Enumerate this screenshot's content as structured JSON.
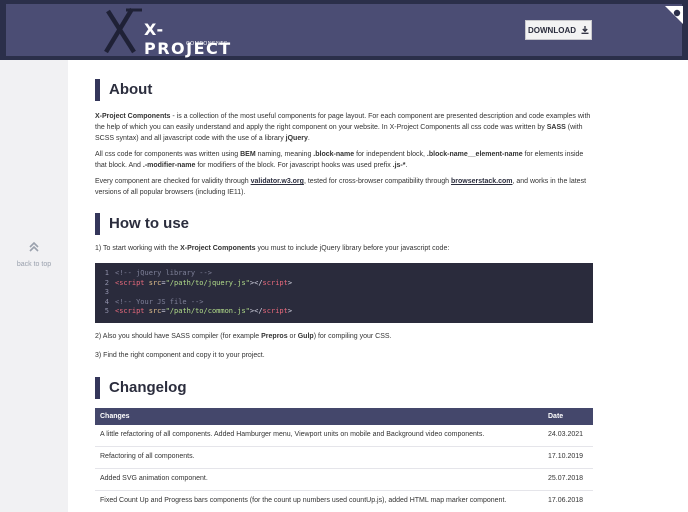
{
  "header": {
    "logo_main": "X-PROJECT",
    "logo_sub": "COMPONENTS",
    "download_label": "DOWNLOAD"
  },
  "sidebar": {
    "back_to_top": "back to top"
  },
  "about": {
    "title": "About",
    "p1": {
      "s1": "X-Project Components",
      "t1": " - is a collection of the most useful components for page layout. For each component are presented description and code examples with the help of which you can easily understand and apply the right component on your website. In X-Project Components all css code was written by ",
      "s2": "SASS",
      "t2": " (with SCSS syntax) and all javascript code with the use of a library ",
      "s3": "jQuery",
      "t3": "."
    },
    "p2": {
      "t1": "All css code for components was written using ",
      "s1": "BEM",
      "t2": " naming, meaning ",
      "s2": ".block-name",
      "t3": " for independent block, ",
      "s3": ".block-name__element-name",
      "t4": " for elements inside that block. And ",
      "s4": ".-modifier-name",
      "t5": " for modifiers of the block. For javascript hooks was used prefix ",
      "s5": ".js-*",
      "t6": "."
    },
    "p3": {
      "t1": "Every component are checked for validity through ",
      "l1": "validator.w3.org",
      "t2": ", tested for cross-browser compatibility through ",
      "l2": "browserstack.com",
      "t3": ", and works in the latest versions of all popular browsers (including IE11)."
    }
  },
  "howto": {
    "title": "How to use",
    "step1": {
      "t1": "1) To start working with the ",
      "s1": "X-Project Components",
      "t2": " you must to include jQuery library before your javascript code:"
    },
    "code": [
      {
        "n": "1",
        "comment": "<!-- jQuery library -->"
      },
      {
        "n": "2",
        "tag_open": "<script",
        "attr": " src",
        "eq": "=",
        "val": "\"/path/to/jquery.js\"",
        "close": "></",
        "tag_close": "script",
        "end": ">"
      },
      {
        "n": "3"
      },
      {
        "n": "4",
        "comment": "<!-- Your JS file -->"
      },
      {
        "n": "5",
        "tag_open": "<script",
        "attr": " src",
        "eq": "=",
        "val": "\"/path/to/common.js\"",
        "close": "></",
        "tag_close": "script",
        "end": ">"
      }
    ],
    "step2": {
      "t1": "2) Also you should have SASS compiler (for example ",
      "s1": "Prepros",
      "t2": " or ",
      "s2": "Gulp",
      "t3": ") for compiling your CSS."
    },
    "step3": "3) Find the right component and copy it to your project."
  },
  "changelog": {
    "title": "Changelog",
    "col_changes": "Changes",
    "col_date": "Date",
    "rows": [
      {
        "change": "A little refactoring of all components. Added Hamburger menu, Viewport units on mobile and Background video components.",
        "date": "24.03.2021"
      },
      {
        "change": "Refactoring of all components.",
        "date": "17.10.2019"
      },
      {
        "change": "Added SVG animation component.",
        "date": "25.07.2018"
      },
      {
        "change": "Fixed Count Up and Progress bars components (for the count up numbers used countUp.js), added HTML map marker component.",
        "date": "17.06.2018"
      }
    ]
  }
}
